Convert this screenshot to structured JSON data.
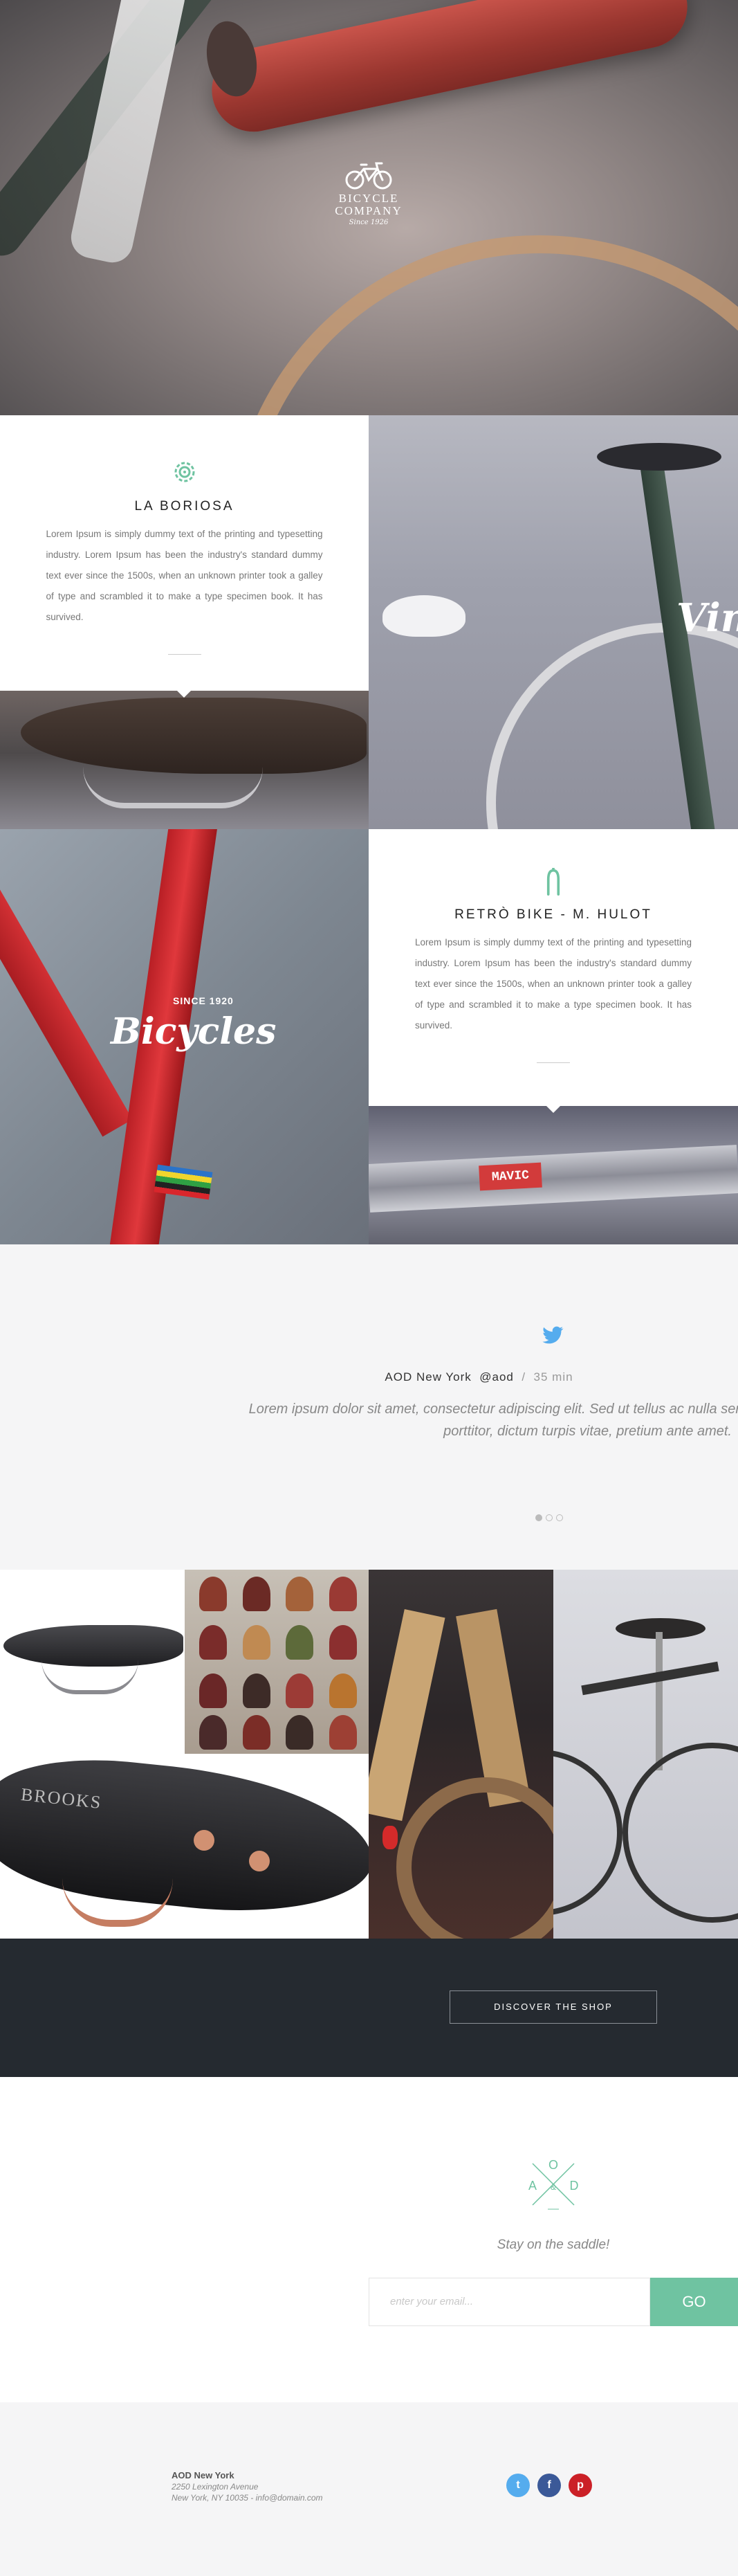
{
  "brand": {
    "line1": "BICYCLE",
    "line2": "COMPANY",
    "since": "Since 1926"
  },
  "colors": {
    "accent": "#6fc3a1",
    "dark": "#252a30",
    "twitter": "#55acee",
    "facebook": "#3b5998",
    "pinterest": "#cb2027"
  },
  "feature1": {
    "title": "LA BORIOSA",
    "body": "Lorem Ipsum is simply dummy text of the printing and typesetting industry. Lorem Ipsum has been the industry's standard dummy text ever since the 1500s, when an unknown printer took a galley of type and scrambled it to make a type specimen book. It has survived.",
    "icon": "gear-icon"
  },
  "feature2": {
    "title": "RETRÒ BIKE - M. HULOT",
    "body": "Lorem Ipsum is simply dummy text of the printing and typesetting industry. Lorem Ipsum has been the industry's standard dummy text ever since the 1500s, when an unknown printer took a galley of type and scrambled it to make a type specimen book. It has survived.",
    "icon": "bike-fork-icon"
  },
  "photo_text": {
    "vintage": "Vin",
    "since": "SINCE 1920",
    "bicycles": "Bicycles",
    "mavic": "MAVIC",
    "brooks": "BROOKS"
  },
  "tweet": {
    "author": "AOD New York",
    "handle": "@aod",
    "separator": "/",
    "time": "35 min",
    "line1": "Lorem ipsum dolor sit amet, consectetur adipiscing elit. Sed ut tellus ac nulla ser",
    "line2": "porttitor, dictum turpis vitae, pretium ante amet.",
    "slides": 3,
    "active_slide": 1
  },
  "shop": {
    "button": "DISCOVER THE SHOP"
  },
  "newsletter": {
    "monogram": {
      "top": "O",
      "left": "A",
      "center": "&",
      "right": "D"
    },
    "tagline": "Stay on the saddle!",
    "placeholder": "enter your email...",
    "go": "GO"
  },
  "footer": {
    "name": "AOD New York",
    "street": "2250 Lexington Avenue",
    "city": "New York, NY 10035 -",
    "email": "info@domain.com",
    "social": [
      {
        "icon": "twitter-icon",
        "glyph": "t"
      },
      {
        "icon": "facebook-icon",
        "glyph": "f"
      },
      {
        "icon": "pinterest-icon",
        "glyph": "p"
      }
    ]
  }
}
